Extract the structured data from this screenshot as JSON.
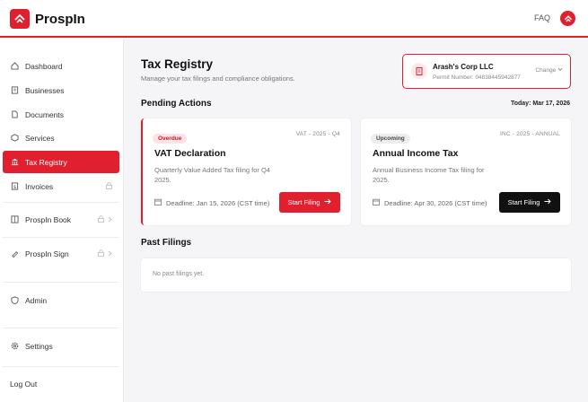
{
  "app": {
    "name": "ProspIn",
    "brand_color": "#e0202e"
  },
  "header": {
    "faq_label": "FAQ"
  },
  "sidebar": {
    "items": [
      {
        "label": "Dashboard",
        "icon": "home-icon"
      },
      {
        "label": "Businesses",
        "icon": "building-icon"
      },
      {
        "label": "Documents",
        "icon": "document-icon"
      },
      {
        "label": "Services",
        "icon": "box-icon"
      },
      {
        "label": "Tax Registry",
        "icon": "bank-icon",
        "active": true
      },
      {
        "label": "Invoices",
        "icon": "invoice-icon",
        "locked": true
      },
      {
        "label": "ProspIn Book",
        "icon": "book-icon",
        "locked": true
      },
      {
        "label": "ProspIn Sign",
        "icon": "sign-icon",
        "locked": true
      },
      {
        "label": "Admin",
        "icon": "shield-icon"
      },
      {
        "label": "Settings",
        "icon": "gear-icon"
      },
      {
        "label": "Log Out"
      }
    ]
  },
  "page": {
    "title": "Tax Registry",
    "subtitle": "Manage your tax filings and compliance obligations."
  },
  "company": {
    "name": "Arash's Corp LLC",
    "permit": "Permit Number: 04838445942877",
    "change_label": "Change"
  },
  "pending": {
    "title": "Pending Actions",
    "today": "Today: Mar 17, 2026",
    "cards": [
      {
        "badge": "Overdue",
        "code": "VAT - 2025 - Q4",
        "title": "VAT Declaration",
        "desc": "Quarterly Value Added Tax filing for Q4 2025.",
        "deadline": "Deadline: Jan 15, 2026 (CST time)",
        "button": "Start Filing"
      },
      {
        "badge": "Upcoming",
        "code": "INC - 2025 - ANNUAL",
        "title": "Annual Income Tax",
        "desc": "Annual Business Income Tax filing for 2025.",
        "deadline": "Deadline: Apr 30, 2026 (CST time)",
        "button": "Start Filing"
      }
    ]
  },
  "past": {
    "title": "Past Filings",
    "empty": "No past filings yet."
  }
}
